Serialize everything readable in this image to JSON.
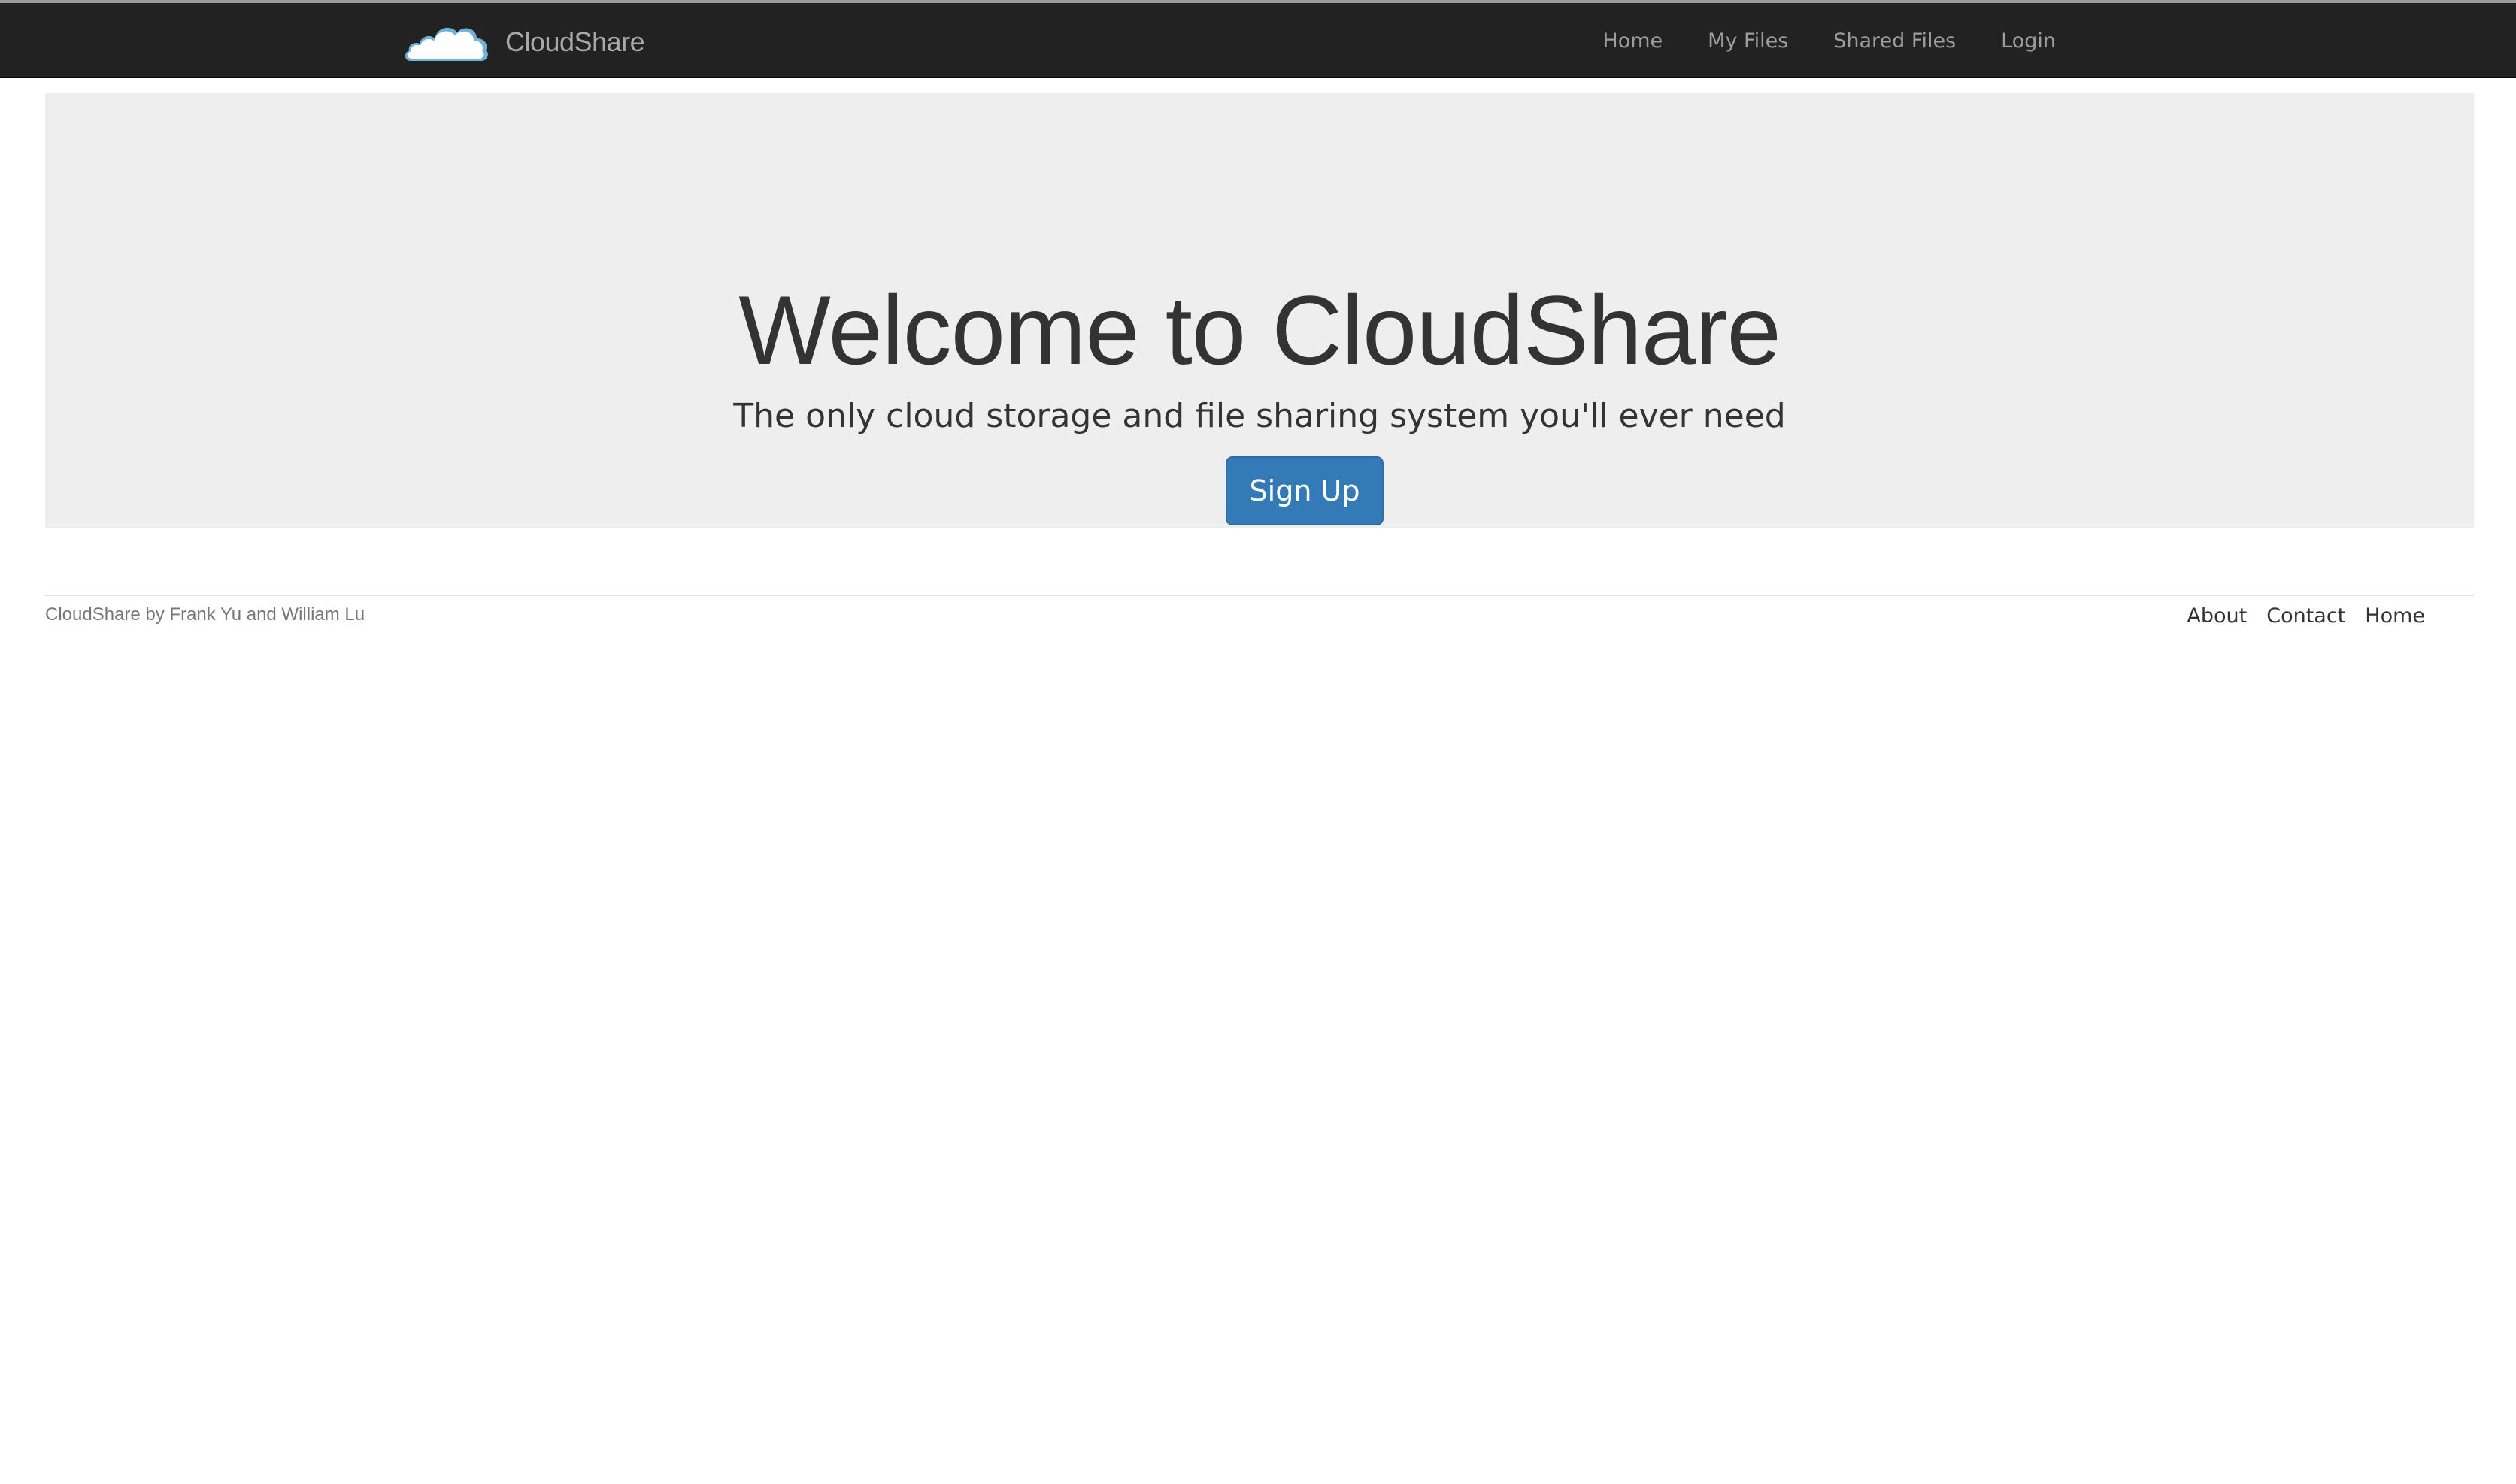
{
  "navbar": {
    "brand_name": "CloudShare",
    "logo_icon": "cloud-icon",
    "links": [
      "Home",
      "My Files",
      "Shared Files",
      "Login"
    ]
  },
  "hero": {
    "title": "Welcome to CloudShare",
    "subtitle": "The only cloud storage and file sharing system you'll ever need",
    "signup_label": "Sign Up"
  },
  "footer": {
    "credit": "CloudShare by Frank Yu and William Lu",
    "links": [
      "About",
      "Contact",
      "Home"
    ]
  },
  "colors": {
    "navbar_bg": "#222222",
    "jumbotron_bg": "#eeeeee",
    "primary_button": "#337ab7",
    "nav_text": "#9d9d9d"
  }
}
